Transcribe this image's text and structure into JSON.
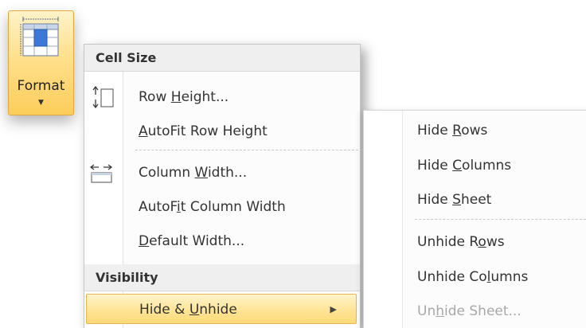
{
  "format_button": {
    "label": "Format",
    "icon": "format-table-icon"
  },
  "menu": {
    "sections": [
      {
        "header": "Cell Size",
        "items": [
          {
            "pre": "Row ",
            "key": "H",
            "post": "eight...",
            "icon": "row-height-icon"
          },
          {
            "pre": "",
            "key": "A",
            "post": "utoFit Row Height"
          },
          {
            "pre": "Column ",
            "key": "W",
            "post": "idth...",
            "icon": "column-width-icon"
          },
          {
            "pre": "AutoF",
            "key": "i",
            "post": "t Column Width"
          },
          {
            "pre": "",
            "key": "D",
            "post": "efault Width..."
          }
        ]
      },
      {
        "header": "Visibility",
        "items": [
          {
            "pre": "Hide & ",
            "key": "U",
            "post": "nhide",
            "submenu": true,
            "highlighted": true
          }
        ]
      }
    ]
  },
  "submenu": {
    "items": [
      {
        "pre": "Hide ",
        "key": "R",
        "post": "ows"
      },
      {
        "pre": "Hide ",
        "key": "C",
        "post": "olumns"
      },
      {
        "pre": "Hide ",
        "key": "S",
        "post": "heet"
      },
      {
        "pre": "Unhide R",
        "key": "o",
        "post": "ws"
      },
      {
        "pre": "Unhide Co",
        "key": "l",
        "post": "umns"
      },
      {
        "pre": "Un",
        "key": "h",
        "post": "ide Sheet...",
        "disabled": true
      }
    ]
  },
  "colors": {
    "highlight_gradient_top": "#fff4cc",
    "highlight_gradient_bottom": "#fdd978",
    "highlight_border": "#e6b64f",
    "text": "#333333",
    "disabled_text": "#a8a8a8"
  }
}
